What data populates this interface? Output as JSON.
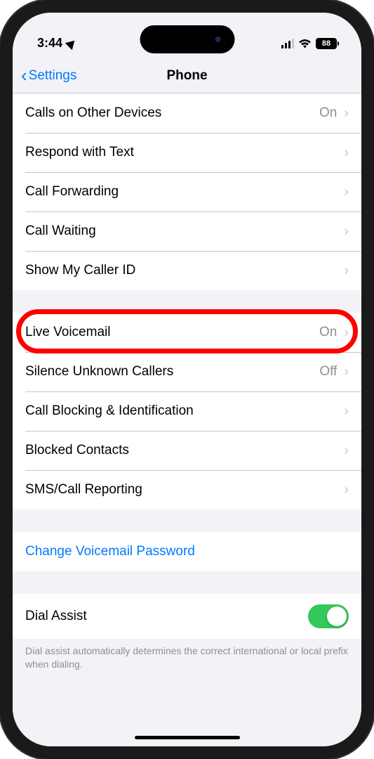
{
  "status_bar": {
    "time": "3:44",
    "battery": "88"
  },
  "nav": {
    "back_label": "Settings",
    "title": "Phone"
  },
  "section1": [
    {
      "label": "Calls on Other Devices",
      "value": "On"
    },
    {
      "label": "Respond with Text",
      "value": ""
    },
    {
      "label": "Call Forwarding",
      "value": ""
    },
    {
      "label": "Call Waiting",
      "value": ""
    },
    {
      "label": "Show My Caller ID",
      "value": ""
    }
  ],
  "section2": [
    {
      "label": "Live Voicemail",
      "value": "On",
      "highlighted": true
    },
    {
      "label": "Silence Unknown Callers",
      "value": "Off"
    },
    {
      "label": "Call Blocking & Identification",
      "value": ""
    },
    {
      "label": "Blocked Contacts",
      "value": ""
    },
    {
      "label": "SMS/Call Reporting",
      "value": ""
    }
  ],
  "section3": {
    "link": "Change Voicemail Password"
  },
  "section4": {
    "label": "Dial Assist",
    "enabled": true,
    "footer": "Dial assist automatically determines the correct international or local prefix when dialing."
  }
}
